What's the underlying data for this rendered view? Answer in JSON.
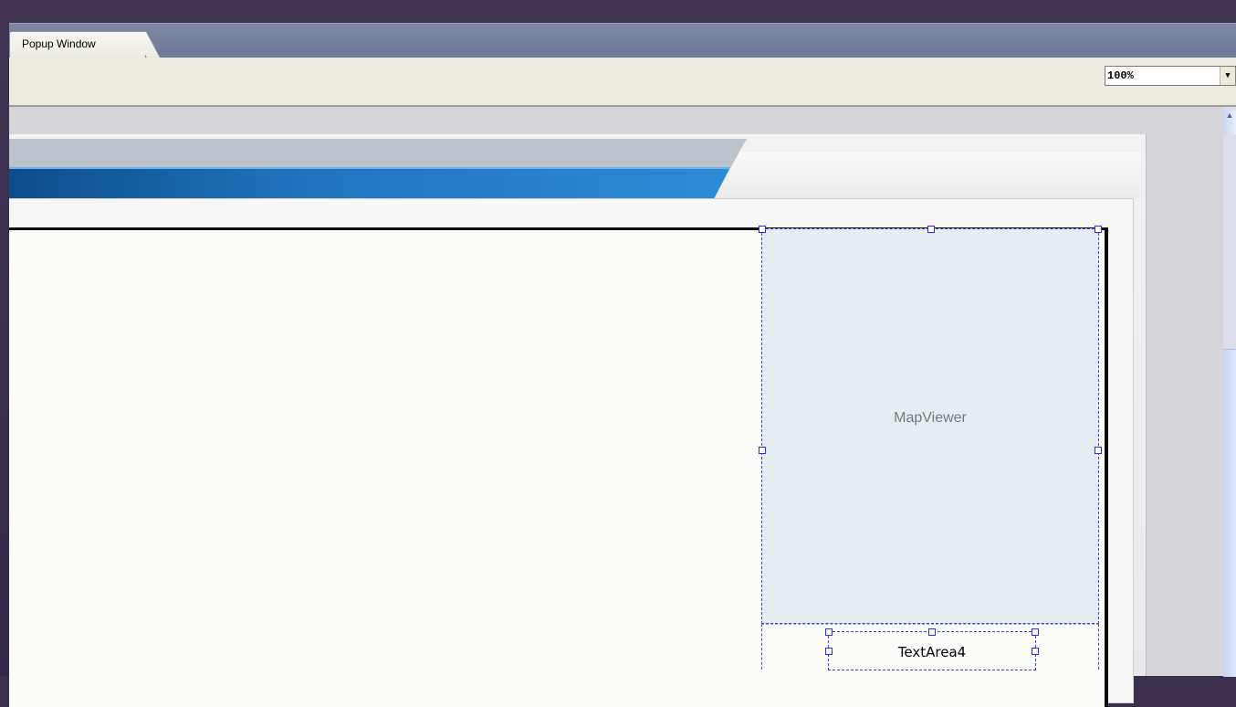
{
  "tabs": [
    {
      "label": "Popup Window",
      "active": true
    }
  ],
  "toolbar": {
    "zoom": "100%"
  },
  "designer": {
    "map_viewer_label": "MapViewer",
    "text_area_label": "TextArea4"
  },
  "colors": {
    "accent_blue": "#2e8bd6",
    "selection": "#3c3cf0"
  }
}
